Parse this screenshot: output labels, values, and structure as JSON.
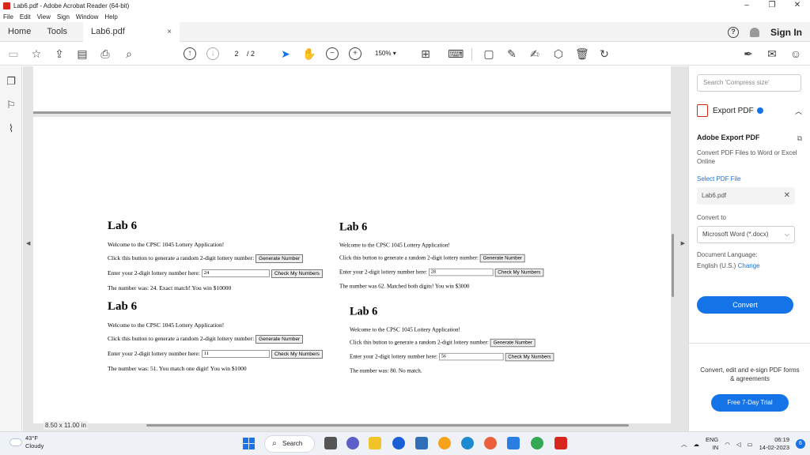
{
  "window": {
    "title": "Lab6.pdf - Adobe Acrobat Reader (64-bit)",
    "minimize": "–",
    "maximize": "❐",
    "close": "✕"
  },
  "menu": [
    "File",
    "Edit",
    "View",
    "Sign",
    "Window",
    "Help"
  ],
  "tabs": {
    "home": "Home",
    "tools": "Tools",
    "document": "Lab6.pdf",
    "close": "×",
    "sign_in": "Sign In"
  },
  "toolbar": {
    "page_current": "2",
    "page_total": "/ 2",
    "zoom": "150%"
  },
  "document": {
    "page_size": "8.50 x 11.00 in",
    "blocks": [
      {
        "heading": "Lab 6",
        "welcome": "Welcome to the CPSC 1045 Lottery Application!",
        "generate_prompt": "Click this button to generate a random 2-digit lottery number:",
        "generate_button": "Generate Number",
        "enter_prompt": "Enter your 2-digit lottery number here:",
        "input_value": "24",
        "check_button": "Check My Numbers",
        "result": "The number was: 24. Exact match! You win $10000"
      },
      {
        "heading": "Lab 6",
        "welcome": "Welcome to the CPSC 1045 Lottery Application!",
        "generate_prompt": "Click this button to generate a random 2-digit lottery number:",
        "generate_button": "Generate Number",
        "enter_prompt": "Enter your 2-digit lottery number here:",
        "input_value": "28",
        "check_button": "Check My Numbers",
        "result": "The number was 62. Matched both digits! You win $3000"
      },
      {
        "heading": "Lab 6",
        "welcome": "Welcome to the CPSC 1045 Lottery Application!",
        "generate_prompt": "Click this button to generate a random 2-digit lottery number:",
        "generate_button": "Generate Number",
        "enter_prompt": "Enter your 2-digit lottery number here:",
        "input_value": "11",
        "check_button": "Check My Numbers",
        "result": "The number was: 51. You match one digit! You win $1000"
      },
      {
        "heading": "Lab 6",
        "welcome": "Welcome to the CPSC 1045 Lottery Application!",
        "generate_prompt": "Click this button to generate a random 2-digit lottery number:",
        "generate_button": "Generate Number",
        "enter_prompt": "Enter your 2-digit lottery number here:",
        "input_value": "56",
        "check_button": "Check My Numbers",
        "result": "The number was: 80. No match."
      }
    ]
  },
  "right_panel": {
    "search_placeholder": "Search 'Compress size'",
    "export_title": "Export PDF",
    "adobe_export_title": "Adobe Export PDF",
    "adobe_export_desc": "Convert PDF Files to Word or Excel Online",
    "select_pdf": "Select PDF File",
    "file_name": "Lab6.pdf",
    "convert_to_label": "Convert to",
    "convert_to_value": "Microsoft Word (*.docx)",
    "doc_language_label": "Document Language:",
    "doc_language_value": "English (U.S.)",
    "change_link": "Change",
    "convert_button": "Convert",
    "promo_text": "Convert, edit and e-sign PDF forms & agreements",
    "trial_button": "Free 7-Day Trial"
  },
  "taskbar": {
    "temperature": "43°F",
    "condition": "Cloudy",
    "search_label": "Search",
    "language": "ENG",
    "region": "IN",
    "time": "06:19",
    "date": "14-02-2023",
    "notifications": "6"
  },
  "colors": {
    "accent": "#1473e6",
    "brand_red": "#d9261c"
  }
}
